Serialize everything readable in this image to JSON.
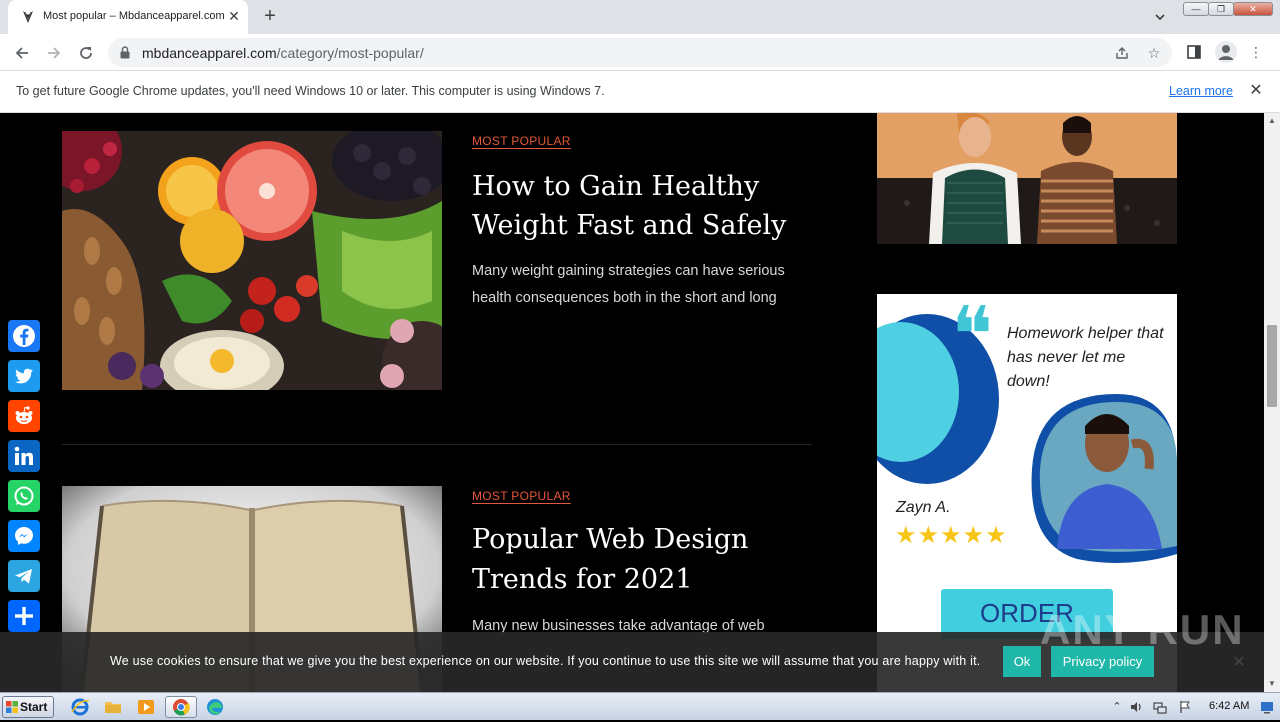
{
  "browser": {
    "tab_title": "Most popular – Mbdanceapparel.com",
    "tab_close": "✕",
    "new_tab": "+",
    "url_domain": "mbdanceapparel.com",
    "url_path": "/category/most-popular/",
    "window_buttons": [
      "—",
      "❐",
      "✕"
    ]
  },
  "infobar": {
    "message": "To get future Google Chrome updates, you'll need Windows 10 or later. This computer is using Windows 7.",
    "learn_more": "Learn more",
    "close": "✕"
  },
  "posts": [
    {
      "category": "MOST POPULAR",
      "title": "How to Gain Healthy Weight Fast and Safely",
      "excerpt": "Many weight gaining strategies can have serious health consequences both in the short and long"
    },
    {
      "category": "MOST POPULAR",
      "title": "Popular Web Design Trends for 2021",
      "excerpt": "Many new businesses take advantage of web"
    }
  ],
  "ad": {
    "quote_mark": "❝",
    "headline": "Homework helper that has never let me down!",
    "name": "Zayn A.",
    "stars": "★★★★★",
    "rating": 5,
    "cta": "ORDER"
  },
  "share_bar": [
    {
      "name": "facebook",
      "color": "#1877f2"
    },
    {
      "name": "twitter",
      "color": "#1d9bf0"
    },
    {
      "name": "reddit",
      "color": "#ff4500"
    },
    {
      "name": "linkedin",
      "color": "#0a66c2"
    },
    {
      "name": "whatsapp",
      "color": "#25d366"
    },
    {
      "name": "messenger",
      "color": "#0084ff"
    },
    {
      "name": "telegram",
      "color": "#2ca5e0"
    },
    {
      "name": "share",
      "color": "#0166ff"
    }
  ],
  "cookie": {
    "message": "We use cookies to ensure that we give you the best experience on our website. If you continue to use this site we will assume that you are happy with it.",
    "ok": "Ok",
    "privacy": "Privacy policy",
    "close": "✕"
  },
  "watermark": "ANY RUN",
  "taskbar": {
    "start": "Start",
    "time": "6:42 AM"
  }
}
